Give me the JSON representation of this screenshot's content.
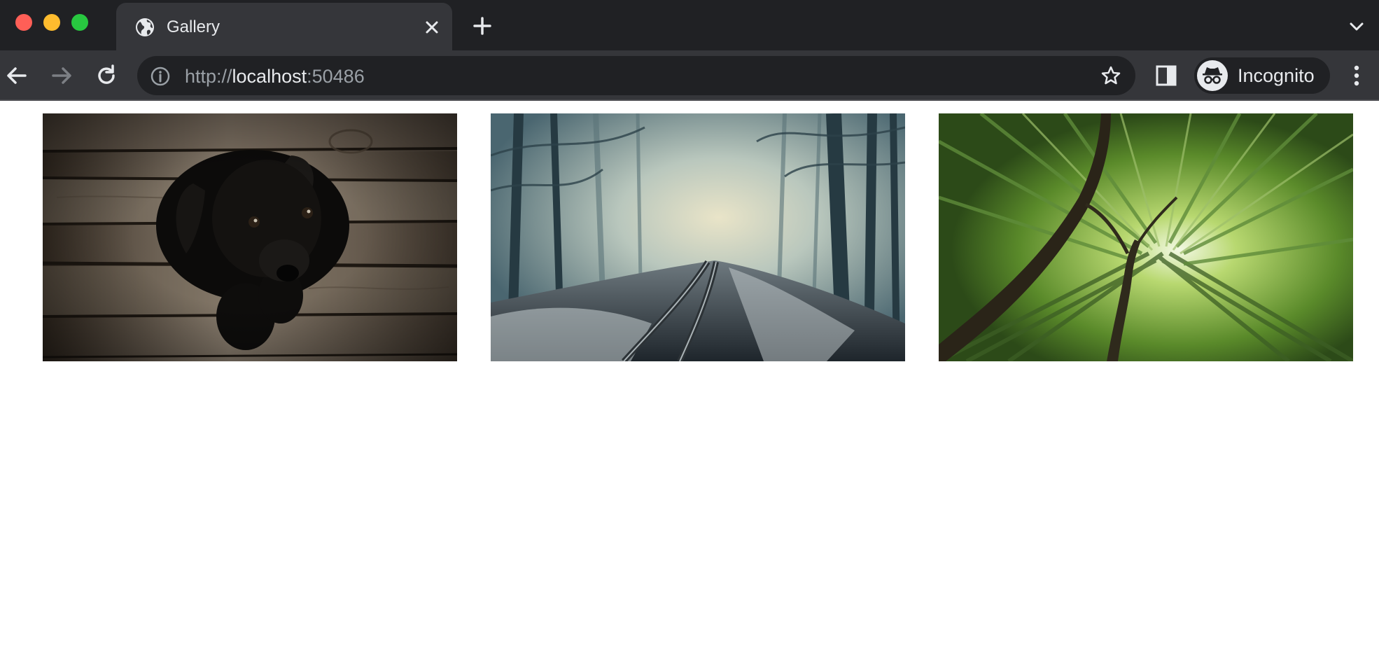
{
  "window": {
    "controls": [
      "close",
      "minimize",
      "maximize"
    ]
  },
  "tab": {
    "title": "Gallery",
    "icon": "globe-icon"
  },
  "toolbar": {
    "url_scheme": "http://",
    "url_host": "localhost",
    "url_port": ":50486",
    "profile_label": "Incognito"
  },
  "gallery": {
    "images": [
      {
        "subject": "black puppy on wooden planks"
      },
      {
        "subject": "misty forest railway track"
      },
      {
        "subject": "bamboo forest looking up"
      }
    ]
  },
  "colors": {
    "chrome_dark": "#202124",
    "chrome_toolbar": "#35363a",
    "text_light": "#e8eaed",
    "text_dim": "#9aa0a6"
  }
}
